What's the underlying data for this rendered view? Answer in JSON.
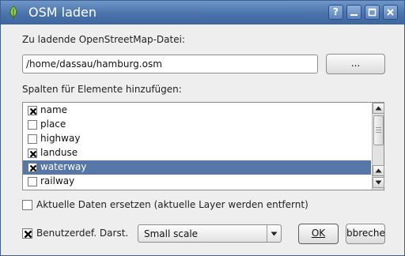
{
  "window": {
    "title": "OSM laden"
  },
  "titlebar_buttons": {
    "help": "?"
  },
  "file": {
    "label": "Zu ladende OpenStreetMap-Datei:",
    "path_value": "/home/dassau/hamburg.osm",
    "browse_label": "..."
  },
  "columns": {
    "label": "Spalten für Elemente hinzufügen:",
    "items": [
      {
        "label": "name",
        "checked": true,
        "selected": false
      },
      {
        "label": "place",
        "checked": false,
        "selected": false
      },
      {
        "label": "highway",
        "checked": false,
        "selected": false
      },
      {
        "label": "landuse",
        "checked": true,
        "selected": false
      },
      {
        "label": "waterway",
        "checked": true,
        "selected": true
      },
      {
        "label": "railway",
        "checked": false,
        "selected": false
      }
    ]
  },
  "options": {
    "replace_label": "Aktuelle Daten ersetzen (aktuelle Layer werden entfernt)",
    "replace_checked": false,
    "custom_style_label": "Benutzerdef. Darst.",
    "custom_style_checked": true,
    "style_select_value": "Small scale"
  },
  "buttons": {
    "ok_label": "OK",
    "cancel_label": "bbreche"
  },
  "colors": {
    "titlebar": "#4a73ac",
    "selection": "#5777a8"
  }
}
